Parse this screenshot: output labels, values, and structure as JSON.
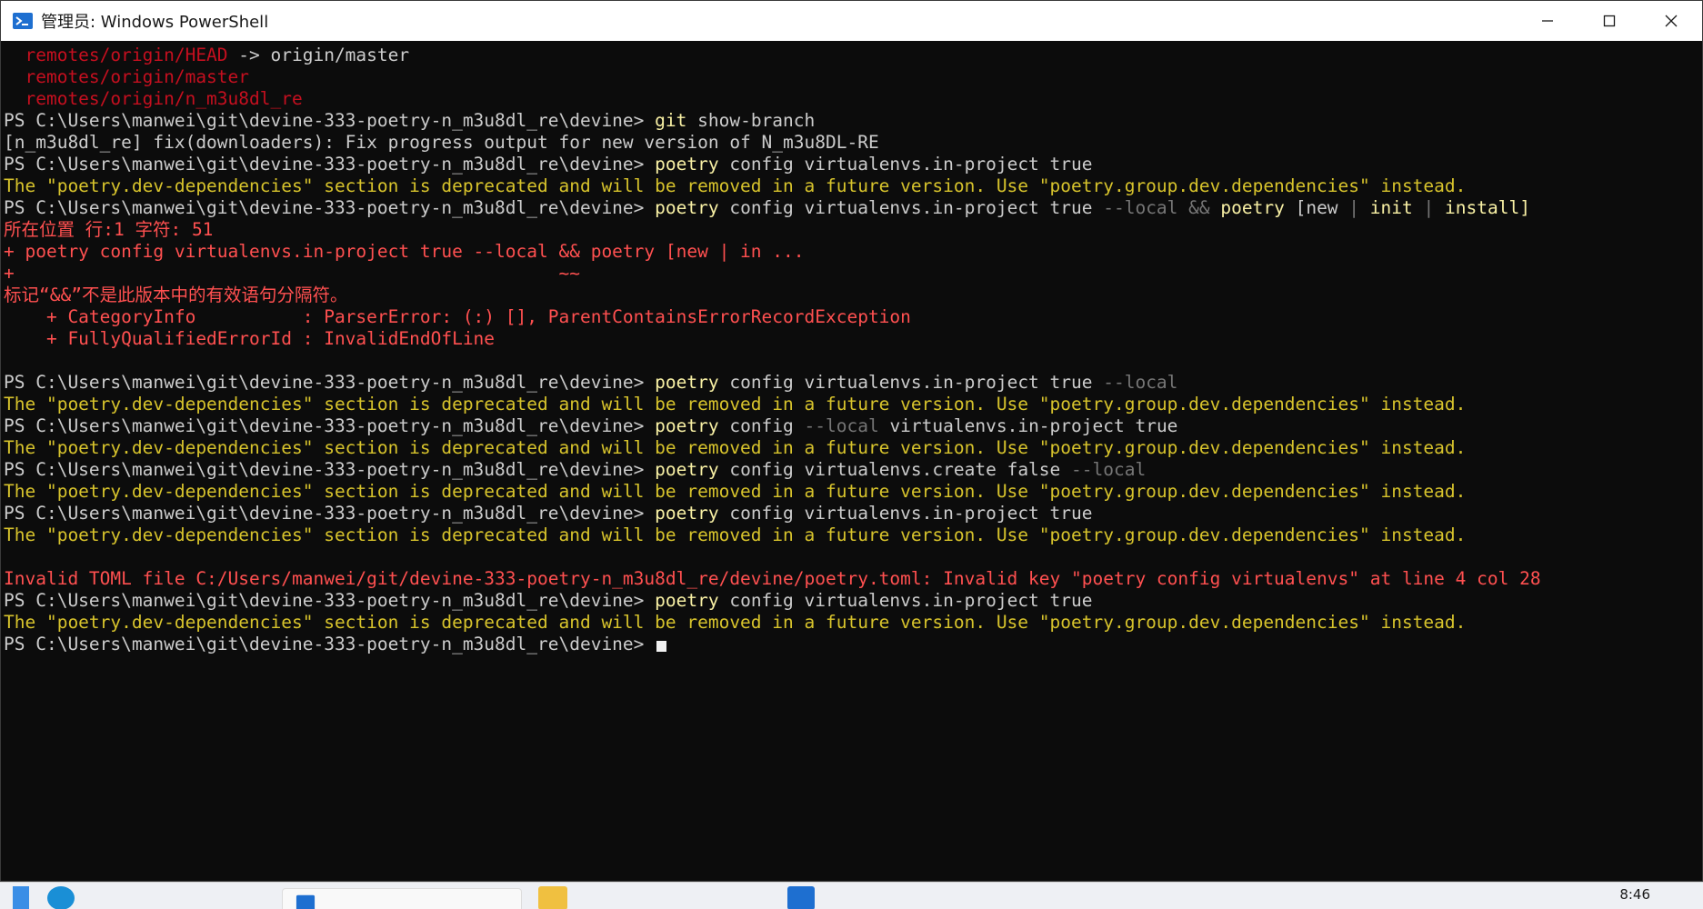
{
  "window": {
    "title": "管理员: Windows PowerShell"
  },
  "console": {
    "lines": [
      [
        {
          "t": "  remotes/origin/HEAD",
          "c": "c-darkred"
        },
        {
          "t": " -> origin/master",
          "c": "c-str"
        }
      ],
      [
        {
          "t": "  remotes/origin/master",
          "c": "c-darkred"
        }
      ],
      [
        {
          "t": "  remotes/origin/n_m3u8dl_re",
          "c": "c-darkred"
        }
      ],
      [
        {
          "t": "PS C:\\Users\\manwei\\git\\devine-333-poetry-n_m3u8dl_re\\devine> ",
          "c": "c-str"
        },
        {
          "t": "git",
          "c": "c-cmd"
        },
        {
          "t": " show-branch",
          "c": "c-str"
        }
      ],
      [
        {
          "t": "[n_m3u8dl_re] fix(downloaders): Fix progress output for new version of N_m3u8DL-RE",
          "c": "c-str"
        }
      ],
      [
        {
          "t": "PS C:\\Users\\manwei\\git\\devine-333-poetry-n_m3u8dl_re\\devine> ",
          "c": "c-str"
        },
        {
          "t": "poetry",
          "c": "c-cmd"
        },
        {
          "t": " config virtualenvs.in-project true",
          "c": "c-str"
        }
      ],
      [
        {
          "t": "The \"poetry.dev-dependencies\" section is deprecated and will be removed in a future version. Use \"poetry.group.dev.dependencies\" instead.",
          "c": "c-warn"
        }
      ],
      [
        {
          "t": "PS C:\\Users\\manwei\\git\\devine-333-poetry-n_m3u8dl_re\\devine> ",
          "c": "c-str"
        },
        {
          "t": "poetry",
          "c": "c-cmd"
        },
        {
          "t": " config virtualenvs.in-project true ",
          "c": "c-str"
        },
        {
          "t": "--local",
          "c": "c-param"
        },
        {
          "t": " && ",
          "c": "c-param"
        },
        {
          "t": "poetry",
          "c": "c-cmd"
        },
        {
          "t": " [new ",
          "c": "c-str"
        },
        {
          "t": "|",
          "c": "c-param"
        },
        {
          "t": " ",
          "c": "c-str"
        },
        {
          "t": "init",
          "c": "c-cmd"
        },
        {
          "t": " ",
          "c": "c-str"
        },
        {
          "t": "|",
          "c": "c-param"
        },
        {
          "t": " ",
          "c": "c-str"
        },
        {
          "t": "install]",
          "c": "c-cmd"
        }
      ],
      [
        {
          "t": "所在位置 行:1 字符: 51",
          "c": "c-errred"
        }
      ],
      [
        {
          "t": "+ poetry config virtualenvs.in-project true --local && poetry [new | in ...",
          "c": "c-errred"
        }
      ],
      [
        {
          "t": "+                                                   ~~",
          "c": "c-errred"
        }
      ],
      [
        {
          "t": "标记“&&”不是此版本中的有效语句分隔符。",
          "c": "c-errred"
        }
      ],
      [
        {
          "t": "    + CategoryInfo          : ParserError: (:) [], ParentContainsErrorRecordException",
          "c": "c-errred"
        }
      ],
      [
        {
          "t": "    + FullyQualifiedErrorId : InvalidEndOfLine",
          "c": "c-errred"
        }
      ],
      [
        {
          "t": " ",
          "c": "c-str"
        }
      ],
      [
        {
          "t": "PS C:\\Users\\manwei\\git\\devine-333-poetry-n_m3u8dl_re\\devine> ",
          "c": "c-str"
        },
        {
          "t": "poetry",
          "c": "c-cmd"
        },
        {
          "t": " config virtualenvs.in-project true ",
          "c": "c-str"
        },
        {
          "t": "--local",
          "c": "c-param"
        }
      ],
      [
        {
          "t": "The \"poetry.dev-dependencies\" section is deprecated and will be removed in a future version. Use \"poetry.group.dev.dependencies\" instead.",
          "c": "c-warn"
        }
      ],
      [
        {
          "t": "PS C:\\Users\\manwei\\git\\devine-333-poetry-n_m3u8dl_re\\devine> ",
          "c": "c-str"
        },
        {
          "t": "poetry",
          "c": "c-cmd"
        },
        {
          "t": " config ",
          "c": "c-str"
        },
        {
          "t": "--local",
          "c": "c-param"
        },
        {
          "t": " virtualenvs.in-project true",
          "c": "c-str"
        }
      ],
      [
        {
          "t": "The \"poetry.dev-dependencies\" section is deprecated and will be removed in a future version. Use \"poetry.group.dev.dependencies\" instead.",
          "c": "c-warn"
        }
      ],
      [
        {
          "t": "PS C:\\Users\\manwei\\git\\devine-333-poetry-n_m3u8dl_re\\devine> ",
          "c": "c-str"
        },
        {
          "t": "poetry",
          "c": "c-cmd"
        },
        {
          "t": " config virtualenvs.create false ",
          "c": "c-str"
        },
        {
          "t": "--local",
          "c": "c-param"
        }
      ],
      [
        {
          "t": "The \"poetry.dev-dependencies\" section is deprecated and will be removed in a future version. Use \"poetry.group.dev.dependencies\" instead.",
          "c": "c-warn"
        }
      ],
      [
        {
          "t": "PS C:\\Users\\manwei\\git\\devine-333-poetry-n_m3u8dl_re\\devine> ",
          "c": "c-str"
        },
        {
          "t": "poetry",
          "c": "c-cmd"
        },
        {
          "t": " config virtualenvs.in-project true",
          "c": "c-str"
        }
      ],
      [
        {
          "t": "The \"poetry.dev-dependencies\" section is deprecated and will be removed in a future version. Use \"poetry.group.dev.dependencies\" instead.",
          "c": "c-warn"
        }
      ],
      [
        {
          "t": " ",
          "c": "c-str"
        }
      ],
      [
        {
          "t": "Invalid TOML file C:/Users/manwei/git/devine-333-poetry-n_m3u8dl_re/devine/poetry.toml: Invalid key \"poetry config virtualenvs\" at line 4 col 28",
          "c": "c-errred"
        }
      ],
      [
        {
          "t": "PS C:\\Users\\manwei\\git\\devine-333-poetry-n_m3u8dl_re\\devine> ",
          "c": "c-str"
        },
        {
          "t": "poetry",
          "c": "c-cmd"
        },
        {
          "t": " config virtualenvs.in-project true",
          "c": "c-str"
        }
      ],
      [
        {
          "t": "The \"poetry.dev-dependencies\" section is deprecated and will be removed in a future version. Use \"poetry.group.dev.dependencies\" instead.",
          "c": "c-warn"
        }
      ],
      [
        {
          "t": "PS C:\\Users\\manwei\\git\\devine-333-poetry-n_m3u8dl_re\\devine> ",
          "c": "c-str"
        }
      ]
    ],
    "cursor_line": 27
  },
  "taskbar": {
    "clock": "8:46"
  },
  "colors": {
    "background": "#0c0c0c",
    "text": "#cccccc",
    "command": "#f9f1a5",
    "warning": "#d7c32c",
    "error": "#ff5050",
    "parameter": "#767676"
  }
}
